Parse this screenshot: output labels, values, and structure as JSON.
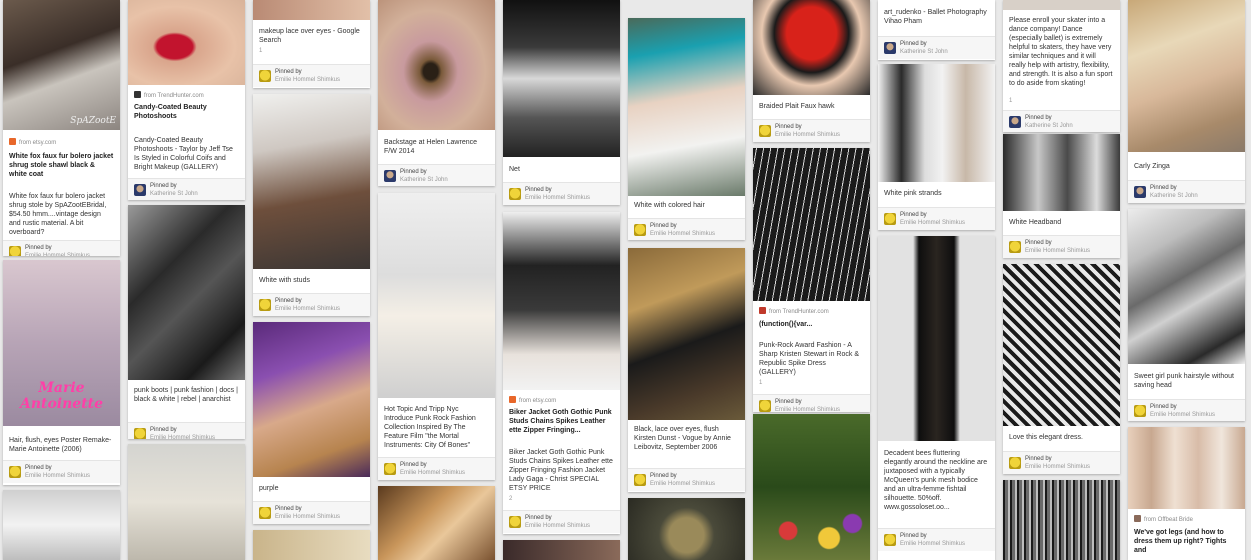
{
  "pinned_label": "Pinned by",
  "pinners": {
    "emilie": "Emilie Hommel Shimkus",
    "katherine": "Katherine St John"
  },
  "pins": {
    "p1": {
      "source": "from etsy.com",
      "title": "White fox faux fur bolero jacket shrug stole shawl black & white coat",
      "desc": "White fox faux fur bolero jacket shrug stole by SpAZootEBridal, $54.50 hmm....vintage design and rustic material. A bit overboard?",
      "watermark": "SpAZootE"
    },
    "p2": {
      "desc": "Hair, flush, eyes Poster Remake- Marie Antoinette (2006)",
      "art_text": "Marie Antoinette"
    },
    "p3": {
      "source": "from TrendHunter.com",
      "title": "Candy-Coated Beauty Photoshoots",
      "desc": "Candy-Coated Beauty Photoshoots - Taylor by Jeff Tse Is Styled in Colorful Coifs and Bright Makeup (GALLERY)"
    },
    "p4": {
      "desc": "punk boots | punk fashion | docs | black & white | rebel | anarchist"
    },
    "p5": {
      "desc": "makeup lace over eyes - Google Search",
      "count": "1"
    },
    "p6": {
      "desc": "White with studs"
    },
    "p7": {
      "desc": "purple"
    },
    "p8": {
      "desc": "Backstage at Helen Lawrence F/W 2014"
    },
    "p9": {
      "desc": "Hot Topic And Tripp Nyc Introduce Punk Rock Fashion Collection Inspired By The Feature Film \"the Mortal Instruments: City Of Bones\""
    },
    "p10": {
      "desc": "Net"
    },
    "p11": {
      "source": "from etsy.com",
      "title": "Biker Jacket Goth Gothic Punk Studs Chains Spikes Leather ette Zipper Fringing...",
      "desc": "Biker Jacket Goth Gothic Punk Studs Chains Spikes Leather ette Zipper Fringing Fashion Jacket Lady Gaga - Christ SPECIAL ETSY PRICE",
      "count": "2"
    },
    "p12": {
      "desc": "White with colored hair"
    },
    "p13": {
      "desc": "Black, lace over eyes, flush Kirsten Dunst - Vogue by Annie Leibovitz, September 2006"
    },
    "p14": {
      "desc": "Braided Plait Faux hawk"
    },
    "p15": {
      "source": "from TrendHunter.com",
      "title": "(function(){var...",
      "desc": "Punk-Rock Award Fashion - A Sharp Kristen Stewart in Rock & Republic Spike Dress (GALLERY)",
      "count": "1"
    },
    "p16": {
      "source": "art_rudenko - Ballet Photography Vihao Pham"
    },
    "p17": {
      "desc": "White pink strands"
    },
    "p18": {
      "desc": "Decadent bees fluttering elegantly around the neckline are juxtaposed with a typically McQueen's punk mesh bodice and an ultra-femme fishtail silhouette. 50%off. www.gossoloset.oo..."
    },
    "p19": {
      "desc": "Please enroll your skater into a dance company! Dance (especially ballet) is extremely helpful to skaters, they have very similar techniques and it will really help with artistry, flexibility, and strength. It is also a fun sport to do aside from skating!",
      "count": "1"
    },
    "p20": {
      "desc": "White Headband"
    },
    "p21": {
      "desc": "Love this elegant dress."
    },
    "p22": {
      "desc": "Carly Zinga"
    },
    "p23": {
      "desc": "Sweet girl punk hairstyle without saving head"
    },
    "p24": {
      "source": "from Offbeat Bride",
      "desc": "We've got legs (and how to dress them up right? Tights and"
    }
  },
  "colors": {
    "background": "#e9e9e9",
    "etsy": "#e8672a",
    "trendhunter": "#c0392b"
  }
}
